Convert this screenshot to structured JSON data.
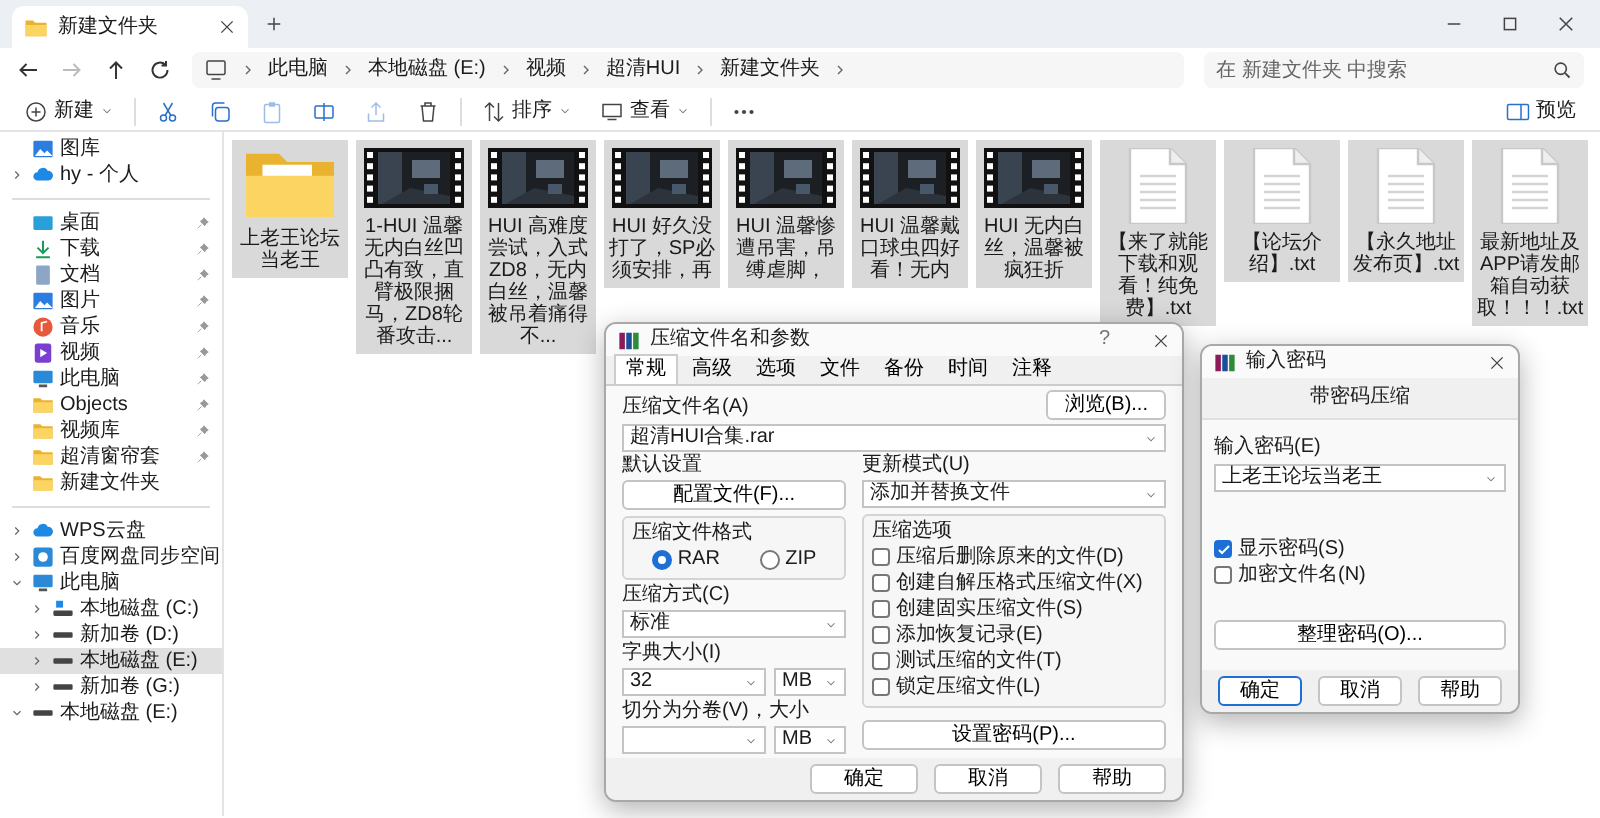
{
  "tabs": [
    {
      "title": "新建文件夹",
      "selected": true
    }
  ],
  "nav": [
    {
      "kind": "back",
      "disabled": false
    },
    {
      "kind": "forward",
      "disabled": true
    },
    {
      "kind": "up",
      "disabled": false
    },
    {
      "kind": "refresh",
      "disabled": false
    }
  ],
  "breadcrumb": [
    "此电脑",
    "本地磁盘 (E:)",
    "视频",
    "超清HUI",
    "新建文件夹"
  ],
  "search": {
    "placeholder": "在 新建文件夹 中搜索"
  },
  "toolbar": [
    {
      "kind": "new",
      "label": "新建",
      "disabled": false
    },
    {
      "kind": "cut",
      "disabled": false
    },
    {
      "kind": "copy",
      "disabled": false
    },
    {
      "kind": "paste",
      "disabled": true
    },
    {
      "kind": "rename",
      "disabled": false
    },
    {
      "kind": "share",
      "disabled": true
    },
    {
      "kind": "delete",
      "disabled": false
    },
    {
      "kind": "sort",
      "label": "排序",
      "disabled": false
    },
    {
      "kind": "view",
      "label": "查看",
      "disabled": false
    },
    {
      "kind": "more",
      "disabled": false
    }
  ],
  "preview": {
    "label": "预览"
  },
  "sidebar": [
    {
      "items": [
        {
          "label": "图库",
          "kind": "gallery",
          "selected": false
        },
        {
          "label": "hy - 个人",
          "kind": "cloud",
          "expanded": false,
          "selected": false
        }
      ]
    },
    {
      "items": [
        {
          "label": "桌面",
          "kind": "desktop",
          "pinned": true,
          "selected": false
        },
        {
          "label": "下载",
          "kind": "downloads",
          "pinned": true,
          "selected": false
        },
        {
          "label": "文档",
          "kind": "documents",
          "pinned": true,
          "selected": false
        },
        {
          "label": "图片",
          "kind": "pictures",
          "pinned": true,
          "selected": false
        },
        {
          "label": "音乐",
          "kind": "music",
          "pinned": true,
          "selected": false
        },
        {
          "label": "视频",
          "kind": "videos",
          "pinned": true,
          "selected": false
        },
        {
          "label": "此电脑",
          "kind": "computer",
          "pinned": true,
          "selected": false
        },
        {
          "label": "Objects",
          "kind": "folder",
          "pinned": true,
          "selected": false
        },
        {
          "label": "视频库",
          "kind": "folder",
          "pinned": true,
          "selected": false
        },
        {
          "label": "超清窗帘套",
          "kind": "folder",
          "pinned": true,
          "selected": false
        },
        {
          "label": "新建文件夹",
          "kind": "folder",
          "pinned": false,
          "selected": false
        }
      ]
    },
    {
      "items": [
        {
          "label": "WPS云盘",
          "kind": "cloud",
          "expanded": false,
          "selected": false
        },
        {
          "label": "百度网盘同步空间",
          "kind": "sync",
          "expanded": false,
          "selected": false
        },
        {
          "label": "此电脑",
          "kind": "computer",
          "expanded": true,
          "selected": false,
          "children": [
            {
              "label": "本地磁盘 (C:)",
              "kind": "system-drive",
              "expanded": false,
              "selected": false
            },
            {
              "label": "新加卷 (D:)",
              "kind": "drive",
              "expanded": false,
              "selected": false
            },
            {
              "label": "本地磁盘 (E:)",
              "kind": "drive",
              "expanded": false,
              "selected": true
            },
            {
              "label": "新加卷 (G:)",
              "kind": "drive",
              "expanded": false,
              "selected": false
            }
          ]
        },
        {
          "label": "本地磁盘 (E:)",
          "kind": "drive",
          "expanded": true,
          "selected": false
        }
      ]
    }
  ],
  "files": [
    {
      "name": "上老王论坛当老王",
      "kind": "folder",
      "selected": true
    },
    {
      "name": "1-HUI 温馨无内白丝凹凸有致，直臂极限捆马，ZD8轮番攻击...",
      "kind": "video",
      "selected": true
    },
    {
      "name": "HUI 高难度尝试，入式ZD8，无内白丝，温馨被吊着痛得不...",
      "kind": "video",
      "selected": true
    },
    {
      "name": "HUI 好久没打了，SP必须安排，再",
      "kind": "video",
      "selected": true
    },
    {
      "name": "HUI 温馨惨遭吊害，吊缚虐脚，",
      "kind": "video",
      "selected": true
    },
    {
      "name": "HUI 温馨戴口球虫四好看！无内",
      "kind": "video",
      "selected": true
    },
    {
      "name": "HUI 无内白丝，温馨被疯狂折",
      "kind": "video",
      "selected": true
    },
    {
      "name": "【来了就能下载和观看！纯免费】.txt",
      "kind": "text",
      "selected": true
    },
    {
      "name": "【论坛介绍】.txt",
      "kind": "text",
      "selected": true
    },
    {
      "name": "【永久地址发布页】.txt",
      "kind": "text",
      "selected": true
    },
    {
      "name": "最新地址及APP请发邮箱自动获取！！！.txt",
      "kind": "text",
      "selected": true
    }
  ],
  "archive_dialog": {
    "title": "压缩文件名和参数",
    "help_mark": "?",
    "tabs": [
      {
        "label": "常规",
        "selected": true
      },
      {
        "label": "高级",
        "selected": false
      },
      {
        "label": "选项",
        "selected": false
      },
      {
        "label": "文件",
        "selected": false
      },
      {
        "label": "备份",
        "selected": false
      },
      {
        "label": "时间",
        "selected": false
      },
      {
        "label": "注释",
        "selected": false
      }
    ],
    "archive_name": {
      "label": "压缩文件名(A)",
      "value": "超清HUI合集.rar"
    },
    "browse_button": "浏览(B)...",
    "profiles": {
      "label": "默认设置",
      "button": "配置文件(F)..."
    },
    "update_mode": {
      "label": "更新模式(U)",
      "value": "添加并替换文件"
    },
    "format": {
      "label": "压缩文件格式",
      "options": [
        {
          "label": "RAR",
          "selected": true
        },
        {
          "label": "ZIP",
          "selected": false
        }
      ]
    },
    "method": {
      "label": "压缩方式(C)",
      "value": "标准"
    },
    "dictionary": {
      "label": "字典大小(I)",
      "value": "32",
      "unit": "MB"
    },
    "volumes": {
      "label": "切分为分卷(V)，大小",
      "unit": "MB"
    },
    "options": {
      "label": "压缩选项",
      "items": [
        {
          "label": "压缩后删除原来的文件(D)",
          "checked": false
        },
        {
          "label": "创建自解压格式压缩文件(X)",
          "checked": false
        },
        {
          "label": "创建固实压缩文件(S)",
          "checked": false
        },
        {
          "label": "添加恢复记录(E)",
          "checked": false
        },
        {
          "label": "测试压缩的文件(T)",
          "checked": false
        },
        {
          "label": "锁定压缩文件(L)",
          "checked": false
        }
      ]
    },
    "password_button": "设置密码(P)...",
    "buttons": [
      {
        "label": "确定",
        "default": false
      },
      {
        "label": "取消",
        "default": false
      },
      {
        "label": "帮助",
        "default": false
      }
    ]
  },
  "password_dialog": {
    "title": "输入密码",
    "heading": "带密码压缩",
    "password": {
      "label": "输入密码(E)",
      "value": "上老王论坛当老王"
    },
    "checks": [
      {
        "label": "显示密码(S)",
        "checked": true
      },
      {
        "label": "加密文件名(N)",
        "checked": false
      }
    ],
    "organize_button": "整理密码(O)...",
    "buttons": [
      {
        "label": "确定",
        "default": true
      },
      {
        "label": "取消",
        "default": false
      },
      {
        "label": "帮助",
        "default": false
      }
    ]
  }
}
